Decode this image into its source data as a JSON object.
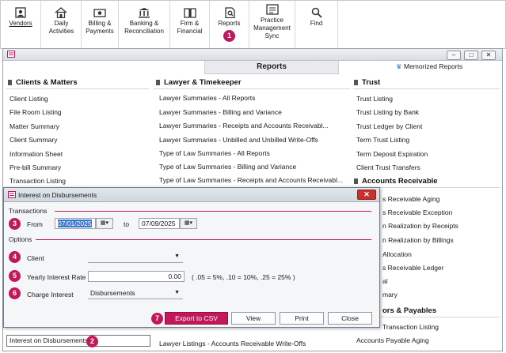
{
  "toolbar": {
    "items": [
      {
        "label": "Vendors",
        "icon": "vendors-icon"
      },
      {
        "label": "Daily Activities",
        "icon": "home-icon"
      },
      {
        "label": "Billing & Payments",
        "icon": "money-icon"
      },
      {
        "label": "Banking & Reconciliation",
        "icon": "bank-icon"
      },
      {
        "label": "Firm & Financial",
        "icon": "book-icon"
      },
      {
        "label": "Reports",
        "icon": "reports-icon"
      },
      {
        "label": "Practice Management Sync",
        "icon": "sync-icon"
      },
      {
        "label": "Find",
        "icon": "magnifier-icon"
      }
    ],
    "badge": "1"
  },
  "window": {
    "tab_title": "Reports",
    "memorized": "Memorized Reports"
  },
  "columns": {
    "clients": {
      "title": "Clients & Matters",
      "items": [
        "Client Listing",
        "File Room Listing",
        "Matter Summary",
        "Client Summary",
        "Information Sheet",
        "Pre-bill Summary",
        "Transaction Listing"
      ]
    },
    "lawyer": {
      "title": "Lawyer & Timekeeper",
      "items": [
        "Lawyer Summaries - All Reports",
        "Lawyer Summaries - Billing and Variance",
        "Lawyer Summaries - Receipts and Accounts Receivabl...",
        "Lawyer Summaries - Unbilled and Unbilled Write-Offs",
        "Type of Law Summaries - All Reports",
        "Type of Law Summaries - Billing and Variance",
        "Type of Law Summaries - Receipts and Accounts Receivabl..."
      ],
      "bottom_item": "Lawyer Listings - Accounts Receivable Write-Offs"
    },
    "trust": {
      "title": "Trust",
      "items": [
        "Trust Listing",
        "Trust Listing by Bank",
        "Trust Ledger by Client",
        "Term Trust Listing",
        "Term Deposit Expiration",
        "Client Trust Transfers"
      ]
    },
    "ar": {
      "title": "Accounts Receivable",
      "items": [
        "s Receivable Aging",
        "s Receivable Exception",
        "n Realization by Receipts",
        "n Realization by Billings",
        "Allocation",
        "s Receivable Ledger",
        "al",
        "mary"
      ]
    },
    "ap": {
      "title": "ors & Payables",
      "items": [
        "Transaction Listing",
        "Accounts Payable Aging"
      ]
    }
  },
  "bottom_field": "Interest on Disbursements",
  "bottom_badge": "2",
  "dialog": {
    "title": "Interest on Disbursements",
    "transactions_label": "Transactions",
    "from_label": "From",
    "from_value": "07/01/2025",
    "to_label": "to",
    "to_value": "07/09/2025",
    "options_label": "Options",
    "client_label": "Client",
    "client_value": "",
    "rate_label": "Yearly Interest Rate",
    "rate_value": "0.00",
    "rate_hint": "( .05 = 5%, .10 = 10%, .25 = 25% )",
    "charge_label": "Charge Interest",
    "charge_value": "Disbursements",
    "badges": [
      "3",
      "4",
      "5",
      "6",
      "7"
    ],
    "buttons": {
      "export": "Export to CSV",
      "view": "View",
      "print": "Print",
      "close": "Close"
    }
  },
  "colors": {
    "accent": "#c2185b",
    "selection": "#3876d2",
    "close": "#c9302c"
  }
}
